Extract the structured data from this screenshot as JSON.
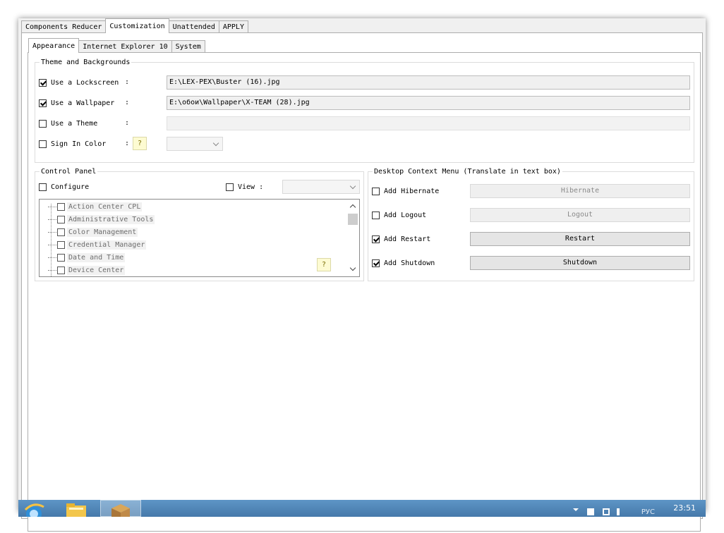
{
  "main_tabs": [
    {
      "label": "Components Reducer"
    },
    {
      "label": "Customization",
      "active": true
    },
    {
      "label": "Unattended"
    },
    {
      "label": "APPLY"
    }
  ],
  "sub_tabs": [
    {
      "label": "Appearance",
      "active": true
    },
    {
      "label": "Internet Explorer 10"
    },
    {
      "label": "System"
    }
  ],
  "theme_group": {
    "title": "Theme and Backgrounds",
    "lockscreen": {
      "label": "Use a Lockscreen",
      "checked": true,
      "colon": ":",
      "value": "E:\\LEX-PEX\\Buster (16).jpg"
    },
    "wallpaper": {
      "label": "Use a Wallpaper",
      "checked": true,
      "colon": ":",
      "value": "E:\\обои\\Wallpaper\\X-TEAM (28).jpg"
    },
    "theme": {
      "label": "Use a Theme",
      "checked": false,
      "colon": ":",
      "value": ""
    },
    "signin": {
      "label": "Sign In Color",
      "checked": false,
      "colon": ":",
      "help": "?"
    }
  },
  "control_panel": {
    "title": "Control Panel",
    "configure_label": "Configure",
    "view_label": "View :",
    "help": "?",
    "items": [
      {
        "label": "Action Center CPL"
      },
      {
        "label": "Administrative Tools"
      },
      {
        "label": "Color Management"
      },
      {
        "label": "Credential Manager"
      },
      {
        "label": "Date and Time"
      },
      {
        "label": "Device Center"
      }
    ]
  },
  "context_menu": {
    "title": "Desktop Context Menu (Translate in text box)",
    "items": [
      {
        "label": "Add Hibernate",
        "checked": false,
        "button": "Hibernate"
      },
      {
        "label": "Add Logout",
        "checked": false,
        "button": "Logout"
      },
      {
        "label": "Add Restart",
        "checked": true,
        "button": "Restart"
      },
      {
        "label": "Add Shutdown",
        "checked": true,
        "button": "Shutdown"
      }
    ]
  },
  "taskbar": {
    "language": "РУС",
    "clock": "23:51",
    "icons": [
      "internet-explorer-icon",
      "file-explorer-icon",
      "package-icon"
    ]
  },
  "colors": {
    "taskbar": "#4f84b8",
    "window_bg": "#f0f0f0",
    "help_button": "#fdfbd2"
  }
}
